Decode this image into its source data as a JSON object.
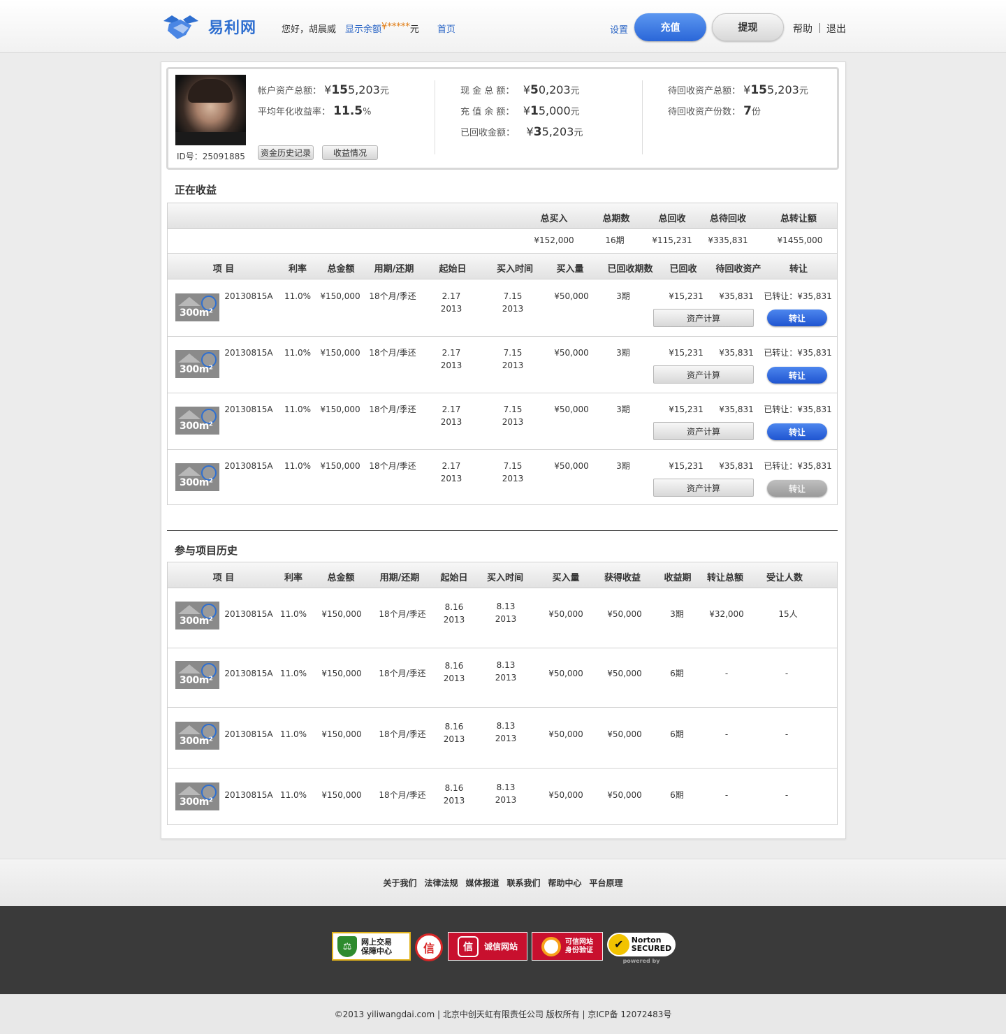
{
  "header": {
    "logo_text": "易利网",
    "greeting": "您好，胡晨威",
    "show_balance": "显示余额",
    "currency": "¥",
    "masked_balance": "*****",
    "yuan": "元",
    "home": "首页",
    "settings": "设置",
    "recharge": "充值",
    "withdraw": "提现",
    "help": "帮助",
    "logout": "退出"
  },
  "account": {
    "id_label": "ID号：25091885",
    "history_btn": "资金历史记录",
    "income_btn": "收益情况",
    "stats": [
      {
        "label": "帐户资产总额：",
        "cur": "¥",
        "bold": "15",
        "rest": "5,203",
        "unit": "元"
      },
      {
        "label": "平均年化收益率：",
        "cur": "",
        "bold": "11.5",
        "rest": "",
        "unit": "%"
      },
      {
        "label": "现 金 总 额：",
        "cur": "¥",
        "bold": "5",
        "rest": "0,203",
        "unit": "元"
      },
      {
        "label": "充 值 余 额：",
        "cur": "¥",
        "bold": "1",
        "rest": "5,000",
        "unit": "元"
      },
      {
        "label": "已回收金额：",
        "cur": "¥",
        "bold": "3",
        "rest": "5,203",
        "unit": "元"
      },
      {
        "label": "待回收资产总额：",
        "cur": "¥",
        "bold": "15",
        "rest": "5,203",
        "unit": "元"
      },
      {
        "label": "待回收资产份数：",
        "cur": "",
        "bold": "7",
        "rest": "",
        "unit": "份"
      }
    ]
  },
  "earning": {
    "title": "正在收益",
    "totals_headers": [
      "总买入",
      "总期数",
      "总回收",
      "总待回收",
      "总转让额"
    ],
    "totals_values": [
      "¥152,000",
      "16期",
      "¥115,231",
      "¥335,831",
      "¥1455,000"
    ],
    "headers": [
      "项 目",
      "利率",
      "总金额",
      "用期/还期",
      "起始日",
      "买入时间",
      "买入量",
      "已回收期数",
      "已回收",
      "待回收资产",
      "转让"
    ],
    "calc_label": "资产计算",
    "transfer_label": "转让",
    "rows": [
      {
        "code": "20130815A",
        "rate": "11.0%",
        "total": "¥150,000",
        "term": "18个月/季还",
        "start": "2.17",
        "start_year": "2013",
        "buy": "7.15",
        "buy_year": "2013",
        "amount": "¥50,000",
        "periods": "3期",
        "recovered": "¥15,231",
        "pending": "¥35,831",
        "transferred": "已转让：¥35,831",
        "transfer_enabled": true
      },
      {
        "code": "20130815A",
        "rate": "11.0%",
        "total": "¥150,000",
        "term": "18个月/季还",
        "start": "2.17",
        "start_year": "2013",
        "buy": "7.15",
        "buy_year": "2013",
        "amount": "¥50,000",
        "periods": "3期",
        "recovered": "¥15,231",
        "pending": "¥35,831",
        "transferred": "已转让：¥35,831",
        "transfer_enabled": true
      },
      {
        "code": "20130815A",
        "rate": "11.0%",
        "total": "¥150,000",
        "term": "18个月/季还",
        "start": "2.17",
        "start_year": "2013",
        "buy": "7.15",
        "buy_year": "2013",
        "amount": "¥50,000",
        "periods": "3期",
        "recovered": "¥15,231",
        "pending": "¥35,831",
        "transferred": "已转让：¥35,831",
        "transfer_enabled": true
      },
      {
        "code": "20130815A",
        "rate": "11.0%",
        "total": "¥150,000",
        "term": "18个月/季还",
        "start": "2.17",
        "start_year": "2013",
        "buy": "7.15",
        "buy_year": "2013",
        "amount": "¥50,000",
        "periods": "3期",
        "recovered": "¥15,231",
        "pending": "¥35,831",
        "transferred": "已转让：¥35,831",
        "transfer_enabled": false
      }
    ]
  },
  "history": {
    "title": "参与项目历史",
    "headers": [
      "项 目",
      "利率",
      "总金额",
      "用期/还期",
      "起始日",
      "买入时间",
      "买入量",
      "获得收益",
      "收益期",
      "转让总额",
      "受让人数"
    ],
    "rows": [
      {
        "code": "20130815A",
        "rate": "11.0%",
        "total": "¥150,000",
        "term": "18个月/季还",
        "start": "8.16",
        "start_year": "2013",
        "buy": "8.13",
        "buy_year": "2013",
        "amount": "¥50,000",
        "gain": "¥50,000",
        "period": "3期",
        "transfer_total": "¥32,000",
        "assignees": "15人"
      },
      {
        "code": "20130815A",
        "rate": "11.0%",
        "total": "¥150,000",
        "term": "18个月/季还",
        "start": "8.16",
        "start_year": "2013",
        "buy": "8.13",
        "buy_year": "2013",
        "amount": "¥50,000",
        "gain": "¥50,000",
        "period": "6期",
        "transfer_total": "-",
        "assignees": "-"
      },
      {
        "code": "20130815A",
        "rate": "11.0%",
        "total": "¥150,000",
        "term": "18个月/季还",
        "start": "8.16",
        "start_year": "2013",
        "buy": "8.13",
        "buy_year": "2013",
        "amount": "¥50,000",
        "gain": "¥50,000",
        "period": "6期",
        "transfer_total": "-",
        "assignees": "-"
      },
      {
        "code": "20130815A",
        "rate": "11.0%",
        "total": "¥150,000",
        "term": "18个月/季还",
        "start": "8.16",
        "start_year": "2013",
        "buy": "8.13",
        "buy_year": "2013",
        "amount": "¥50,000",
        "gain": "¥50,000",
        "period": "6期",
        "transfer_total": "-",
        "assignees": "-"
      }
    ]
  },
  "thumb_label": "300m²",
  "footer": {
    "links": [
      "关于我们",
      "法律法规",
      "媒体报道",
      "联系我们",
      "帮助中心",
      "平台原理"
    ],
    "badges": [
      {
        "text": "网上交易\n保障中心",
        "icon": "shield-scale-icon"
      },
      {
        "text": "信",
        "icon": "trust-seal-icon"
      },
      {
        "text": "诚信网站",
        "icon": "credit-icon"
      },
      {
        "text": "可信网站\n身份验证",
        "icon": "verified-site-icon"
      },
      {
        "text": "Norton\nSECURED",
        "sub": "powered by",
        "icon": "norton-check-icon"
      }
    ],
    "copyright": "©2013 yiliwangdai.com | 北京中创天虹有限责任公司 版权所有 | 京ICP备 12072483号"
  }
}
